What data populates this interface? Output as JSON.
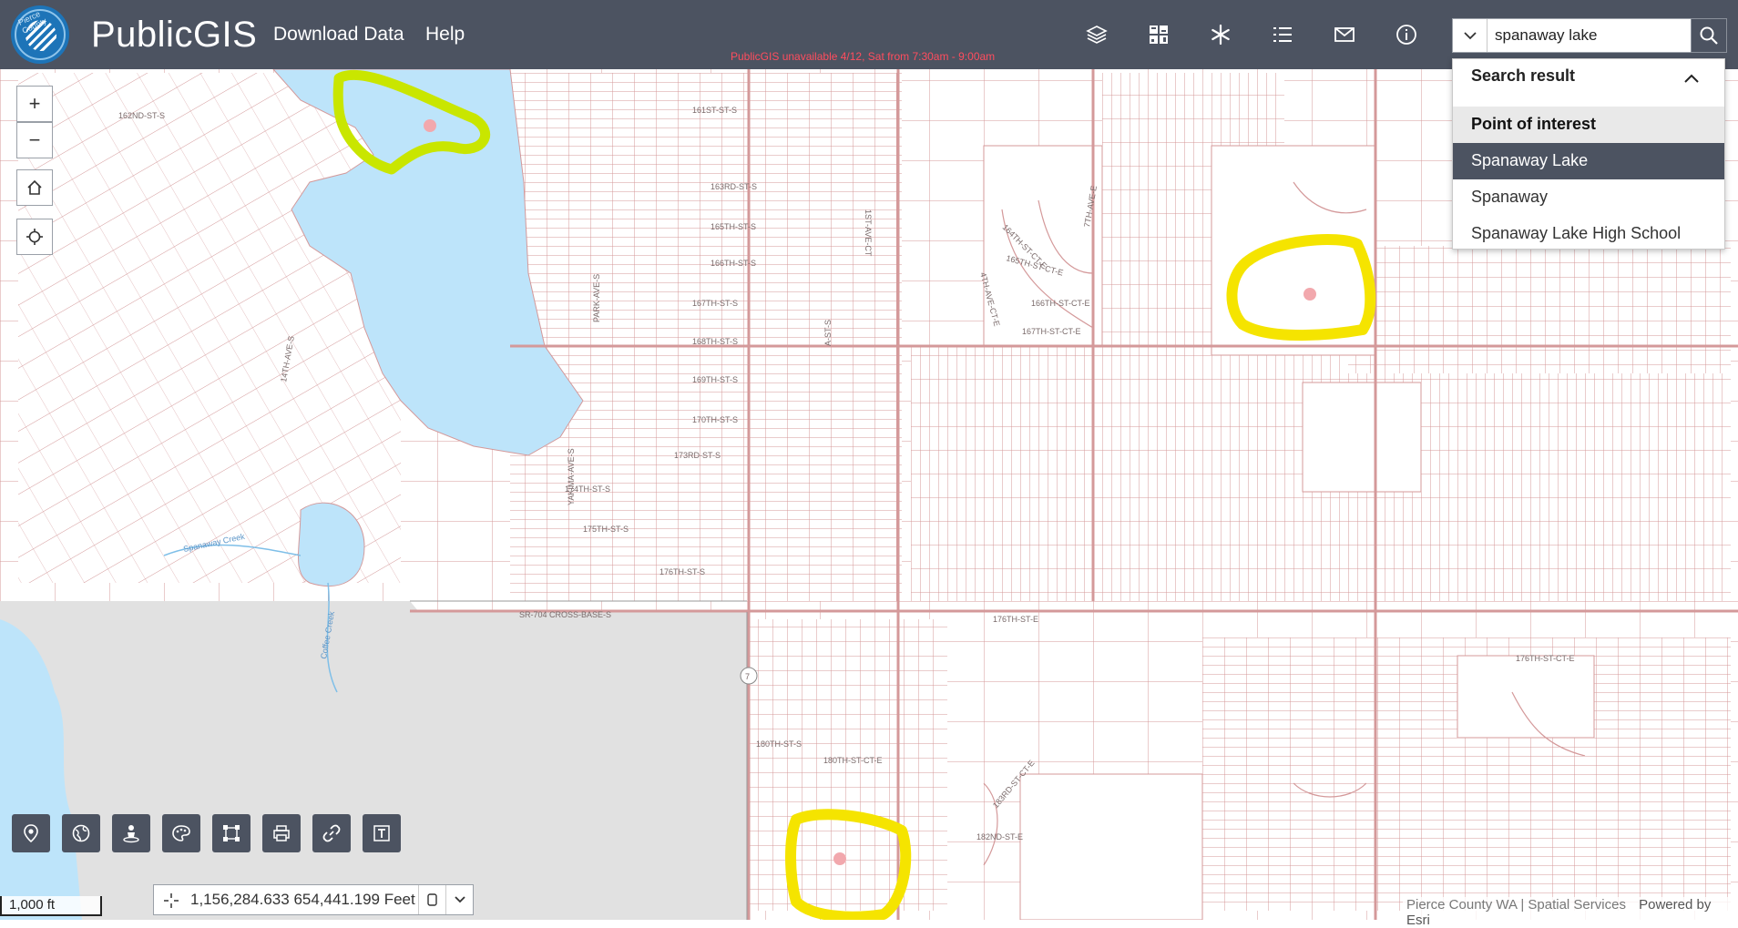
{
  "header": {
    "logo_text": "Pierce County",
    "app_title": "PublicGIS",
    "nav": [
      "Download Data",
      "Help"
    ],
    "notice": "PublicGIS unavailable 4/12, Sat from 7:30am - 9:00am",
    "icons": [
      "layers-icon",
      "basemap-gallery-icon",
      "asterisk-icon",
      "legend-list-icon",
      "mail-icon",
      "info-icon"
    ]
  },
  "search": {
    "value": "spanaway lake",
    "results_title": "Search result",
    "group": "Point of interest",
    "items": [
      "Spanaway Lake",
      "Spanaway",
      "Spanaway Lake High School"
    ],
    "active_index": 0
  },
  "map": {
    "lake_color": "#bde4fa",
    "parcel_color": "#d4999a",
    "highlight_colors": [
      "#c9e600",
      "#f5e400"
    ],
    "street_labels": [
      "161ST-ST-S",
      "162ND-ST-S",
      "163RD-ST-S",
      "165TH-ST-S",
      "166TH-ST-S",
      "167TH-ST-S",
      "168TH-ST-S",
      "169TH-ST-S",
      "170TH-ST-S",
      "173RD-ST-S",
      "174TH-ST-S",
      "175TH-ST-S",
      "176TH-ST-S",
      "176TH-ST-E",
      "SR-704 CROSS-BASE-S",
      "164TH-ST-CT-E",
      "165TH-ST-CT-E",
      "166TH-ST-CT-E",
      "167TH-ST-CT-E",
      "PARK-AVE-S",
      "A-ST-S",
      "1ST-AVE-CT",
      "7TH-AVE-E",
      "4TH-AVE-CT-E",
      "14TH-AVE-S",
      "YAKIMA-AVE-S",
      "Spanaway Creek",
      "Coffee Creek",
      "176TH-ST-CT-E",
      "180TH-ST-S",
      "180TH-ST-CT-E",
      "183RD-ST-CT-E",
      "182ND-ST-E",
      "7"
    ],
    "scale": "1,000 ft",
    "coordinates": "1,156,284.633 654,441.199 Feet",
    "attribution": "Pierce County WA | Spatial Services",
    "powered_by": "Powered by Esri"
  },
  "tools": {
    "zoom_in": "+",
    "zoom_out": "−",
    "bottom": [
      "location-pin-icon",
      "globe-icon",
      "person-icon",
      "palette-icon",
      "select-area-icon",
      "print-icon",
      "link-icon",
      "text-icon"
    ]
  }
}
